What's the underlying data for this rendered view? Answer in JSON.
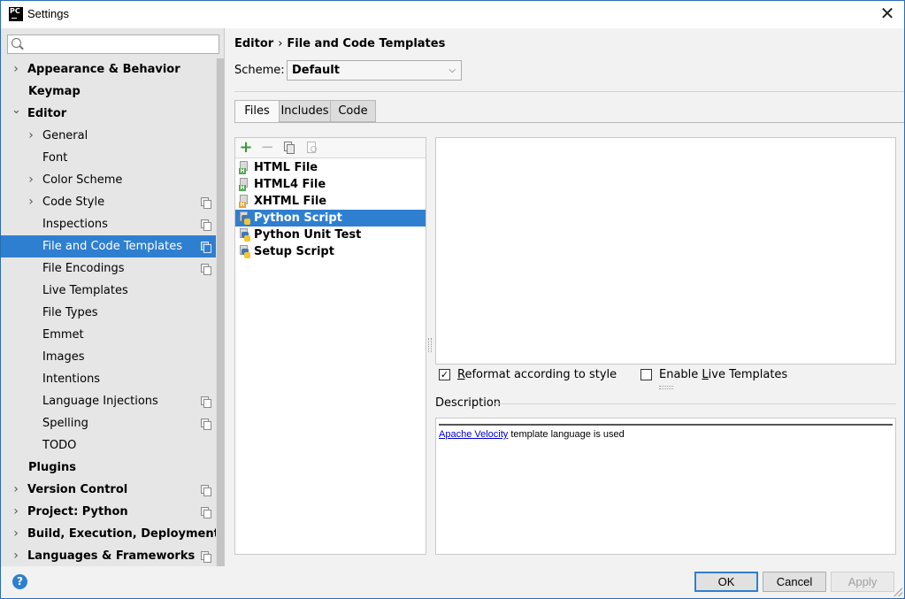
{
  "window": {
    "app_icon_text": "PC",
    "title": "Settings",
    "close_glyph": "✕"
  },
  "search": {
    "placeholder": "",
    "value": ""
  },
  "tree": [
    {
      "label": "Appearance & Behavior",
      "level": 0,
      "expander": "collapsed",
      "bold": true,
      "project_icon": false,
      "selected": false
    },
    {
      "label": "Keymap",
      "level": 0,
      "expander": "none",
      "bold": true,
      "project_icon": false,
      "selected": false
    },
    {
      "label": "Editor",
      "level": 0,
      "expander": "expanded",
      "bold": true,
      "project_icon": false,
      "selected": false
    },
    {
      "label": "General",
      "level": 1,
      "expander": "collapsed",
      "bold": false,
      "project_icon": false,
      "selected": false
    },
    {
      "label": "Font",
      "level": 1,
      "expander": "none",
      "bold": false,
      "project_icon": false,
      "selected": false
    },
    {
      "label": "Color Scheme",
      "level": 1,
      "expander": "collapsed",
      "bold": false,
      "project_icon": false,
      "selected": false
    },
    {
      "label": "Code Style",
      "level": 1,
      "expander": "collapsed",
      "bold": false,
      "project_icon": true,
      "selected": false
    },
    {
      "label": "Inspections",
      "level": 1,
      "expander": "none",
      "bold": false,
      "project_icon": true,
      "selected": false
    },
    {
      "label": "File and Code Templates",
      "level": 1,
      "expander": "none",
      "bold": false,
      "project_icon": true,
      "selected": true
    },
    {
      "label": "File Encodings",
      "level": 1,
      "expander": "none",
      "bold": false,
      "project_icon": true,
      "selected": false
    },
    {
      "label": "Live Templates",
      "level": 1,
      "expander": "none",
      "bold": false,
      "project_icon": false,
      "selected": false
    },
    {
      "label": "File Types",
      "level": 1,
      "expander": "none",
      "bold": false,
      "project_icon": false,
      "selected": false
    },
    {
      "label": "Emmet",
      "level": 1,
      "expander": "none",
      "bold": false,
      "project_icon": false,
      "selected": false
    },
    {
      "label": "Images",
      "level": 1,
      "expander": "none",
      "bold": false,
      "project_icon": false,
      "selected": false
    },
    {
      "label": "Intentions",
      "level": 1,
      "expander": "none",
      "bold": false,
      "project_icon": false,
      "selected": false
    },
    {
      "label": "Language Injections",
      "level": 1,
      "expander": "none",
      "bold": false,
      "project_icon": true,
      "selected": false
    },
    {
      "label": "Spelling",
      "level": 1,
      "expander": "none",
      "bold": false,
      "project_icon": true,
      "selected": false
    },
    {
      "label": "TODO",
      "level": 1,
      "expander": "none",
      "bold": false,
      "project_icon": false,
      "selected": false
    },
    {
      "label": "Plugins",
      "level": 0,
      "expander": "none",
      "bold": true,
      "project_icon": false,
      "selected": false
    },
    {
      "label": "Version Control",
      "level": 0,
      "expander": "collapsed",
      "bold": true,
      "project_icon": true,
      "selected": false
    },
    {
      "label": "Project: Python",
      "level": 0,
      "expander": "collapsed",
      "bold": true,
      "project_icon": true,
      "selected": false
    },
    {
      "label": "Build, Execution, Deployment",
      "level": 0,
      "expander": "collapsed",
      "bold": true,
      "project_icon": false,
      "selected": false
    },
    {
      "label": "Languages & Frameworks",
      "level": 0,
      "expander": "collapsed",
      "bold": true,
      "project_icon": true,
      "selected": false
    }
  ],
  "main": {
    "breadcrumb": [
      "Editor",
      "File and Code Templates"
    ],
    "breadcrumb_sep": "›",
    "scheme_label": "Scheme:",
    "scheme_value": "Default",
    "tabs": [
      {
        "label": "Files",
        "active": true
      },
      {
        "label": "Includes",
        "active": false
      },
      {
        "label": "Code",
        "active": false
      }
    ],
    "toolbar": {
      "add_glyph": "+",
      "remove_glyph": "−"
    },
    "files": [
      {
        "label": "HTML File",
        "icon": "html-file-icon",
        "tag": "H",
        "tag_color": "#4fa84f",
        "selected": false
      },
      {
        "label": "HTML4 File",
        "icon": "html-file-icon",
        "tag": "H",
        "tag_color": "#4fa84f",
        "selected": false
      },
      {
        "label": "XHTML File",
        "icon": "xhtml-file-icon",
        "tag": "H",
        "tag_color": "#e8a33a",
        "selected": false
      },
      {
        "label": "Python Script",
        "icon": "python-file-icon",
        "tag": "",
        "tag_color": "",
        "selected": true
      },
      {
        "label": "Python Unit Test",
        "icon": "python-file-icon",
        "tag": "",
        "tag_color": "",
        "selected": false
      },
      {
        "label": "Setup Script",
        "icon": "python-file-icon",
        "tag": "",
        "tag_color": "",
        "selected": false
      }
    ],
    "options": {
      "reformat": {
        "label_pre": "",
        "label_u": "R",
        "label_post": "eformat according to style",
        "checked": true
      },
      "live_templates": {
        "label_pre": "Enable ",
        "label_u": "L",
        "label_post": "ive Templates",
        "checked": false
      }
    },
    "description_label": "Description",
    "description_link": "Apache Velocity",
    "description_text": " template language is used"
  },
  "footer": {
    "help_glyph": "?",
    "ok": "OK",
    "cancel": "Cancel",
    "apply": "Apply"
  },
  "colors": {
    "selection": "#2f7fd0",
    "sidebar_bg": "#e6e6e6",
    "link": "#0000cc"
  }
}
